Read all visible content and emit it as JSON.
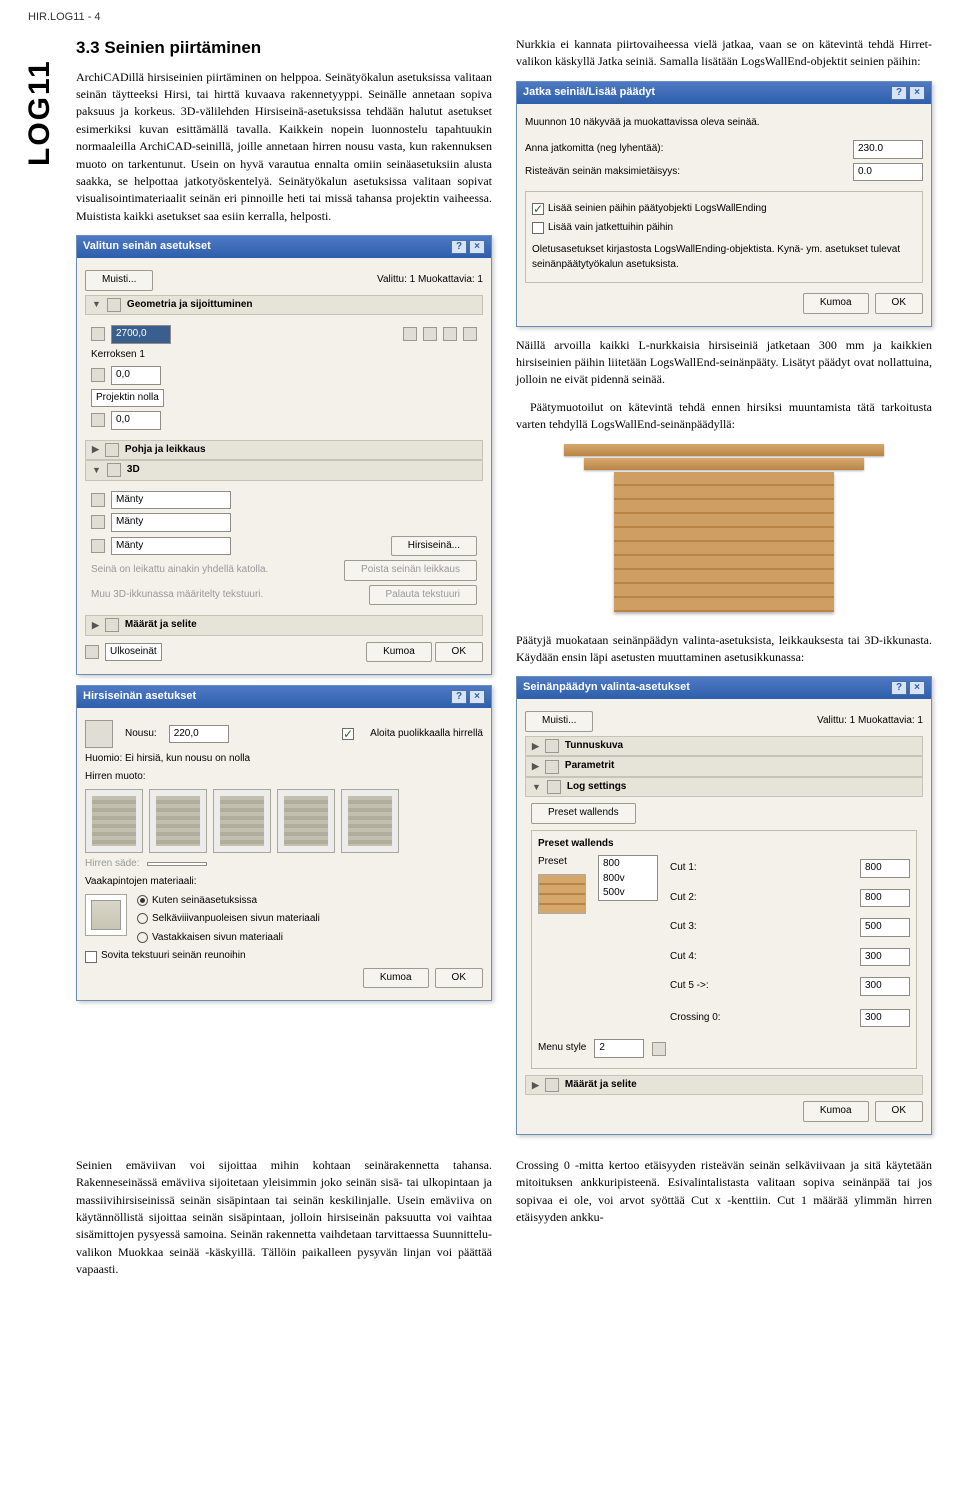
{
  "header_code": "HIR.LOG11 - 4",
  "side_label": "LOG11",
  "section_title": "3.3 Seinien piirtäminen",
  "left_intro": "ArchiCADillä hirsiseinien piirtäminen on helppoa. Seinätyökalun asetuksissa valitaan seinän täytteeksi Hirsi, tai hirttä kuvaava rakennetyyppi. Seinälle annetaan sopiva paksuus ja korkeus. 3D-välilehden Hirsiseinä-asetuksissa tehdään halutut asetukset esimerkiksi kuvan esittämällä tavalla. Kaikkein nopein luonnostelu tapahtuukin normaaleilla ArchiCAD-seinillä, joille annetaan hirren nousu vasta, kun rakennuksen muoto on tarkentunut. Usein on hyvä varautua ennalta omiin seinäasetuksiin alusta saakka, se helpottaa jatkotyöskentelyä. Seinätyökalun asetuksissa valitaan sopivat visualisointimateriaalit seinän eri pinnoille heti tai missä tahansa projektin vaiheessa. Muistista kaikki asetukset saa esiin kerralla, helposti.",
  "right_intro": "Nurkkia ei kannata piirtovaiheessa vielä jatkaa, vaan se on kätevintä tehdä Hirret-valikon käskyllä Jatka seiniä. Samalla lisätään LogsWallEnd-objektit seinien päihin:",
  "after_dialog1": "Näillä arvoilla kaikki L-nurkkaisia hirsiseiniä jatketaan 300 mm ja kaikkien hirsiseinien päihin liitetään LogsWallEnd-seinänpääty. Lisätyt päädyt ovat nollattuina, jolloin ne eivät pidennä seinää.",
  "after_dialog1b": "Päätymuotoilut on kätevintä tehdä ennen hirsiksi muuntamista tätä tarkoitusta varten tehdyllä LogsWallEnd-seinänpäädyllä:",
  "after_render": "Päätyjä muokataan seinänpäädyn valinta-asetuksista, leikkauksesta tai 3D-ikkunasta. Käydään ensin läpi asetusten muuttaminen asetusikkunassa:",
  "bottom_left": "Seinien emäviivan voi sijoittaa mihin kohtaan seinärakennetta tahansa. Rakenneseinässä emäviiva sijoitetaan yleisimmin joko seinän sisä- tai ulkopintaan ja massiivihirsiseinissä seinän sisäpintaan tai seinän keskilinjalle. Usein emäviiva on käytännöllistä sijoittaa seinän sisäpintaan, jolloin hirsiseinän paksuutta voi vaihtaa sisämittojen pysyessä samoina. Seinän rakennetta vaihdetaan tarvittaessa Suunnittelu-valikon Muokkaa seinää -käskyillä. Tällöin paikalleen pysyvän linjan voi päättää vapaasti.",
  "bottom_right": "Crossing 0 -mitta kertoo etäisyyden risteävän seinän selkäviivaan ja sitä käytetään mitoituksen ankkuripisteenä. Esivalintalistasta valitaan sopiva seinänpää tai jos sopivaa ei ole, voi arvot syöttää Cut x -kenttiin. Cut 1 määrää ylimmän hirren etäisyyden ankku-",
  "dlg_valitun": {
    "title": "Valitun seinän asetukset",
    "muisti": "Muisti...",
    "valittu": "Valittu: 1 Muokattavia: 1",
    "sec1": "Geometria ja sijoittuminen",
    "val_height": "2700,0",
    "kerroksen": "Kerroksen 1",
    "val_a": "0,0",
    "projektiin": "Projektin nolla",
    "val_b": "0,0",
    "sec2": "Pohja ja leikkaus",
    "sec3": "3D",
    "manty": "Mänty",
    "hirsiseina_btn": "Hirsiseinä...",
    "note1": "Seinä on leikattu ainakin yhdellä katolla.",
    "poista": "Poista seinän leikkaus",
    "note2": "Muu 3D-ikkunassa määritelty tekstuuri.",
    "palauta": "Palauta tekstuuri",
    "sec4": "Määrät ja selite",
    "ulkoseinat": "Ulkoseinät",
    "kumoa": "Kumoa",
    "ok": "OK"
  },
  "dlg_hirsi": {
    "title": "Hirsiseinän asetukset",
    "nousu_lbl": "Nousu:",
    "nousu_val": "220,0",
    "aloita": "Aloita puolikkaalla hirrellä",
    "huomio": "Huomio: Ei hirsiä, kun nousu on nolla",
    "muoto": "Hirren muoto:",
    "sade": "Hirren säde:",
    "vaakap": "Vaakapintojen materiaali:",
    "r1": "Kuten seinäasetuksissa",
    "r2": "Selkäviiivanpuoleisen sivun materiaali",
    "r3": "Vastakkaisen sivun materiaali",
    "sovita": "Sovita tekstuuri seinän reunoihin",
    "kumoa": "Kumoa",
    "ok": "OK"
  },
  "dlg_jatka": {
    "title": "Jatka seiniä/Lisää päädyt",
    "muunnon": "Muunnon 10 näkyvää ja muokattavissa oleva seinää.",
    "anna": "Anna jatkomitta (neg lyhentää):",
    "anna_val": "230.0",
    "rist": "Risteävän seinän maksimietäisyys:",
    "rist_val": "0.0",
    "chk1": "Lisää seinien päihin päätyobjekti LogsWallEnding",
    "chk2": "Lisää vain jatkettuihin päihin",
    "note": "Oletusasetukset kirjastosta LogsWallEnding-objektista. Kynä- ym. asetukset tulevat seinänpäätytyökalun asetuksista.",
    "kumoa": "Kumoa",
    "ok": "OK"
  },
  "dlg_seinan": {
    "title": "Seinänpäädyn valinta-asetukset",
    "muisti": "Muisti...",
    "valittu": "Valittu: 1 Muokattavia: 1",
    "tunnus": "Tunnuskuva",
    "param": "Parametrit",
    "log": "Log settings",
    "preset_hd": "Preset wallends",
    "preset_lbl": "Preset",
    "preset_txt": "800\n800v\n500v",
    "cut1": "Cut 1:",
    "cut1v": "800",
    "cut2": "Cut 2:",
    "cut2v": "800",
    "cut3": "Cut 3:",
    "cut3v": "500",
    "cut4": "Cut 4:",
    "cut4v": "300",
    "cut5": "Cut 5 ->:",
    "cut5v": "300",
    "crossing": "Crossing 0:",
    "crossingv": "300",
    "menu": "Menu style",
    "menu_val": "2",
    "maarat": "Määrät ja selite",
    "kumoa": "Kumoa",
    "ok": "OK"
  }
}
